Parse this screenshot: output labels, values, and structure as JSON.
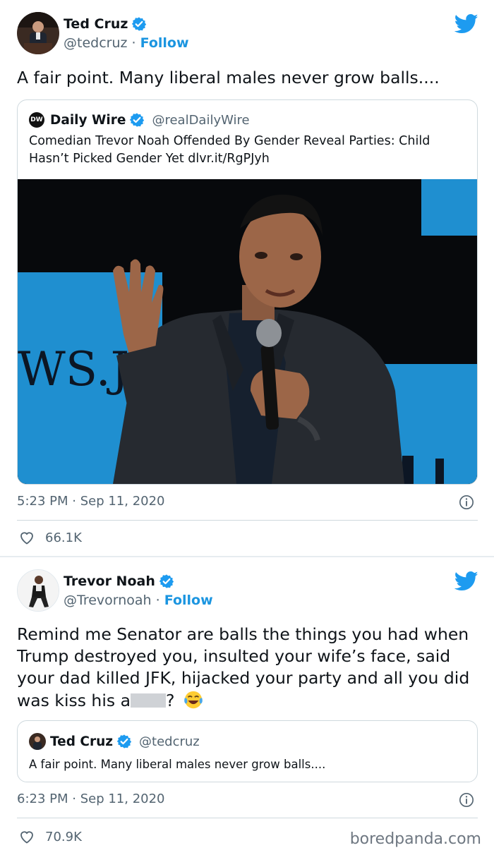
{
  "colors": {
    "link": "#1b95e0",
    "secondary": "#536471",
    "border": "#cfd9de",
    "verified": "#1d9bf0"
  },
  "tweet1": {
    "author": {
      "name": "Ted Cruz",
      "handle": "@tedcruz",
      "separator": "·",
      "follow": "Follow"
    },
    "text": "A fair point. Many liberal males never grow balls....",
    "quote": {
      "logo": "DW",
      "name": "Daily Wire",
      "handle": "@realDailyWire",
      "text": "Comedian Trevor Noah Offended By Gender Reveal Parties: Child Hasn’t Picked Gender Yet dlvr.it/RgPJyh",
      "photo_sign_text": "WS.J",
      "photo_icon": "man-with-microphone-photo"
    },
    "timestamp": "5:23 PM · Sep 11, 2020",
    "likes": "66.1K"
  },
  "tweet2": {
    "author": {
      "name": "Trevor Noah",
      "handle": "@Trevornoah",
      "separator": "·",
      "follow": "Follow"
    },
    "text_main": "Remind me Senator are balls the things you had when Trump destroyed you, insulted your wife’s face, said your dad killed JFK,  hijacked your party and all you did was kiss his a",
    "text_end": "?",
    "emoji": "tears-of-joy-emoji",
    "quote": {
      "name": "Ted Cruz",
      "handle": "@tedcruz",
      "text": "A fair point. Many liberal males never grow balls...."
    },
    "timestamp": "6:23 PM · Sep 11, 2020",
    "likes": "70.9K"
  },
  "watermark": "boredpanda.com"
}
